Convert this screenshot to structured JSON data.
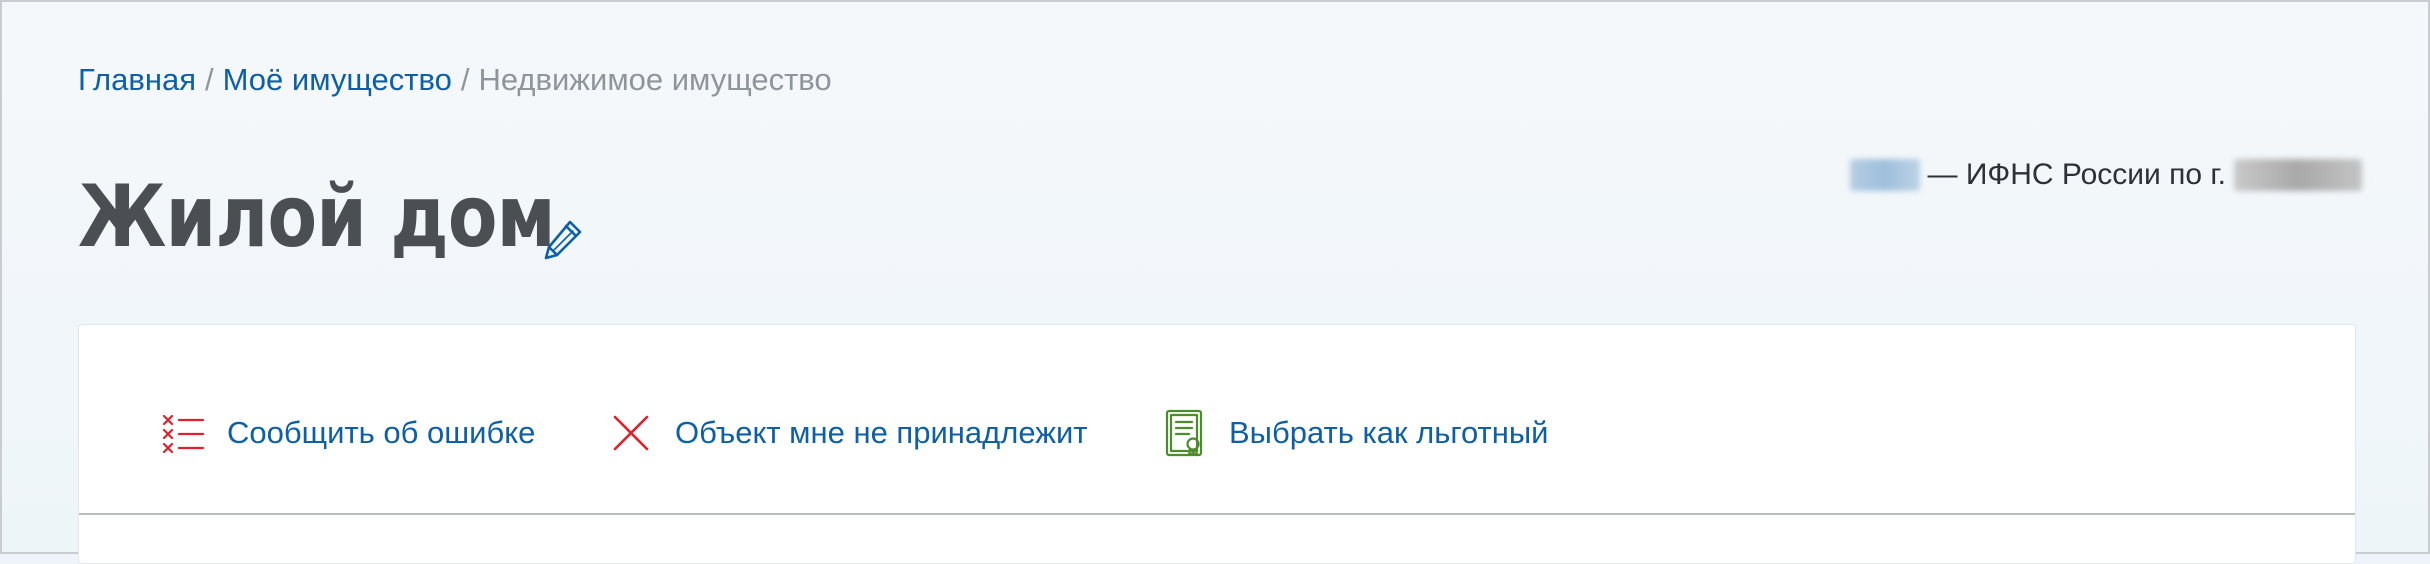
{
  "breadcrumb": {
    "items": [
      "Главная",
      "Моё имущество"
    ],
    "separator": "/",
    "current": "Недвижимое имущество"
  },
  "page": {
    "title": "Жилой дом"
  },
  "inspection": {
    "text": "— ИФНС России по г."
  },
  "actions": [
    {
      "label": "Сообщить об ошибке",
      "icon": "error-list-icon"
    },
    {
      "label": "Объект мне не принадлежит",
      "icon": "close-icon"
    },
    {
      "label": "Выбрать как льготный",
      "icon": "certificate-icon"
    }
  ],
  "colors": {
    "link": "#0d5fa8",
    "muted": "#8e959b",
    "title": "#4b4f54",
    "error_red": "#e0202a",
    "benefit_green": "#4d8c2a",
    "background": "#eef4f9"
  }
}
